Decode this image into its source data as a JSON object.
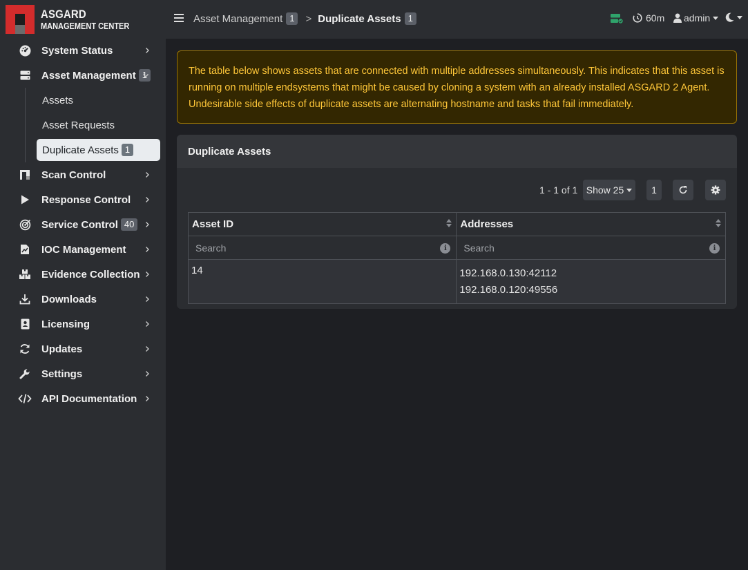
{
  "brand": {
    "line1": "ASGARD",
    "line2": "MANAGEMENT CENTER"
  },
  "sidebar": {
    "items": [
      {
        "label": "System Status",
        "icon": "gauge-icon"
      },
      {
        "label": "Asset Management",
        "icon": "server-icon",
        "badge": "1",
        "expanded": true,
        "children": [
          {
            "label": "Assets"
          },
          {
            "label": "Asset Requests"
          },
          {
            "label": "Duplicate Assets",
            "badge": "1",
            "active": true
          }
        ]
      },
      {
        "label": "Scan Control",
        "icon": "scan-icon"
      },
      {
        "label": "Response Control",
        "icon": "play-icon"
      },
      {
        "label": "Service Control",
        "icon": "target-icon",
        "badge": "40"
      },
      {
        "label": "IOC Management",
        "icon": "file-chart-icon"
      },
      {
        "label": "Evidence Collection",
        "icon": "boxes-icon"
      },
      {
        "label": "Downloads",
        "icon": "download-icon"
      },
      {
        "label": "Licensing",
        "icon": "id-badge-icon"
      },
      {
        "label": "Updates",
        "icon": "sync-icon"
      },
      {
        "label": "Settings",
        "icon": "wrench-icon"
      },
      {
        "label": "API Documentation",
        "icon": "code-icon"
      }
    ]
  },
  "topbar": {
    "breadcrumb": {
      "parent": "Asset Management",
      "parent_badge": "1",
      "separator": ">",
      "current": "Duplicate Assets",
      "current_badge": "1"
    },
    "timer": "60m",
    "user": "admin",
    "status_color": "#2fa36b"
  },
  "alert": {
    "text": "The table below shows assets that are connected with multiple addresses simultaneously. This indicates that this asset is running on multiple endsystems that might be caused by cloning a system with an already installed ASGARD 2 Agent. Undesirable side effects of duplicate assets are alternating hostname and tasks that fail immediately."
  },
  "card": {
    "title": "Duplicate Assets",
    "pagination_text": "1 - 1 of 1",
    "show_label": "Show 25",
    "page": "1",
    "columns": [
      "Asset ID",
      "Addresses"
    ],
    "search_placeholder": "Search",
    "rows": [
      {
        "asset_id": "14",
        "addresses": [
          "192.168.0.130:42112",
          "192.168.0.120:49556"
        ]
      }
    ]
  },
  "colors": {
    "accent_red": "#d32c2c",
    "alert_text": "#ffc739",
    "alert_bg": "#332701"
  }
}
